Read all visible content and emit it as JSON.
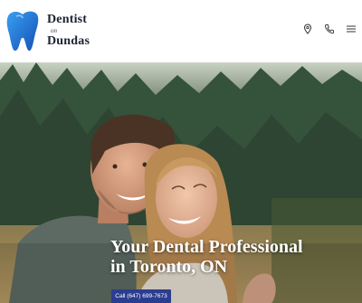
{
  "logo": {
    "line1": "Dentist",
    "line2": "on",
    "line3": "Dundas",
    "icon": "tooth-icon"
  },
  "header_icons": [
    "location-pin-icon",
    "phone-icon",
    "hamburger-menu-icon"
  ],
  "hero": {
    "headline_line1": "Your Dental Professional",
    "headline_line2": "in Toronto, ON",
    "cta_label": "Call (647) 699-7673"
  },
  "colors": {
    "brand_blue": "#2b3d8f",
    "tooth_blue": "#1e78d6",
    "text_dark": "#1b2233"
  }
}
